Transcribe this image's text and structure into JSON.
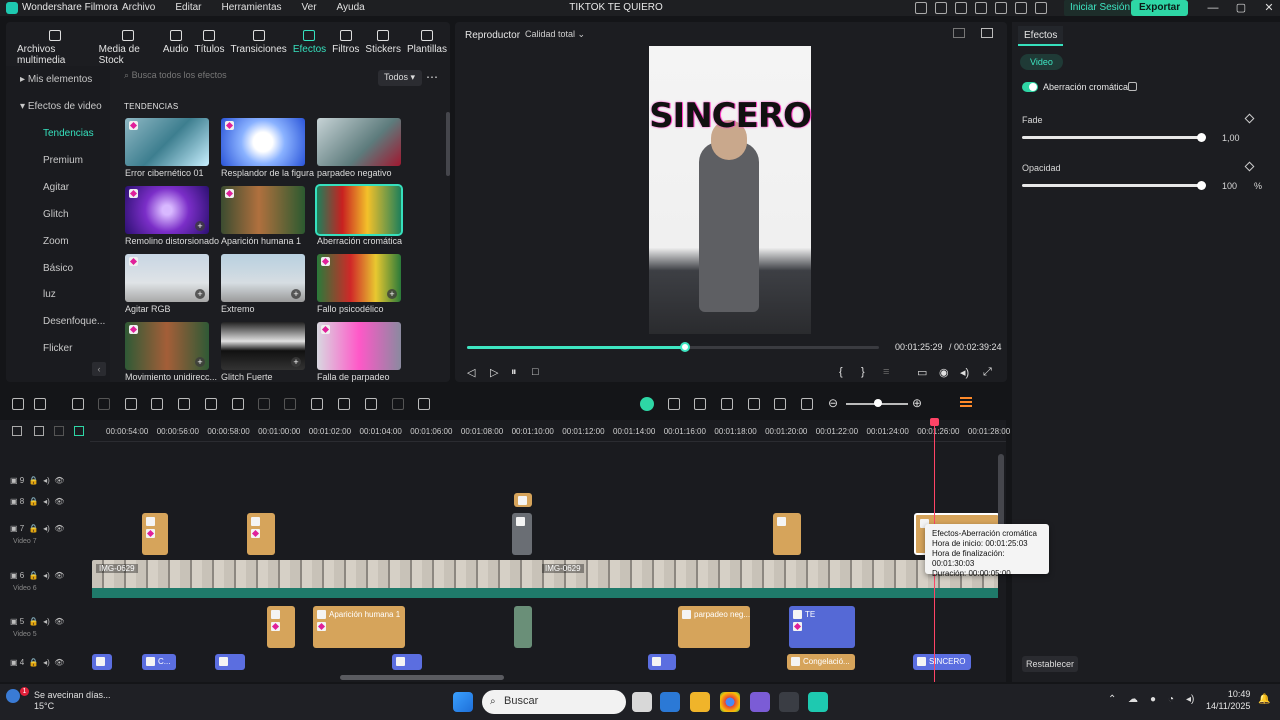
{
  "titlebar": {
    "app_name": "Wondershare Filmora",
    "menu": [
      "Archivo",
      "Editar",
      "Herramientas",
      "Ver",
      "Ayuda"
    ],
    "project_title": "TIKTOK TE QUIERO",
    "login_label": "Iniciar Sesión",
    "export_label": "Exportar"
  },
  "library": {
    "tabs": [
      "Archivos multimedia",
      "Media de Stock",
      "Audio",
      "Títulos",
      "Transiciones",
      "Efectos",
      "Filtros",
      "Stickers",
      "Plantillas"
    ],
    "active_tab": "Efectos",
    "sidebar": [
      "Mis elementos",
      "Efectos de video",
      "Tendencias",
      "Premium",
      "Agitar",
      "Glitch",
      "Zoom",
      "Básico",
      "luz",
      "Desenfoque...",
      "Flicker"
    ],
    "search_placeholder": "Busca todos los efectos",
    "filter_label": "Todos",
    "section_title": "TENDENCIAS",
    "effects": [
      "Error cibernético 01",
      "Resplandor de la figura",
      "parpadeo negativo",
      "Remolino distorsionado",
      "Aparición humana 1",
      "Aberración cromática",
      "Agitar RGB",
      "Extremo",
      "Fallo psicodélico",
      "Movimiento unidirecc...",
      "Glitch Fuerte",
      "Falla de parpadeo"
    ]
  },
  "player": {
    "label": "Reproductor",
    "quality": "Calidad total",
    "overlay_text": "SINCERO",
    "current_time": "00:01:25:29",
    "total_time": "/ 00:02:39:24",
    "progress_fraction": 0.53
  },
  "effects_panel": {
    "tab": "Efectos",
    "chip": "Video",
    "effect_name": "Aberración cromática",
    "fade_label": "Fade",
    "fade_value": "1,00",
    "opacity_label": "Opacidad",
    "opacity_value": "100",
    "opacity_unit": "%",
    "reset_label": "Restablecer"
  },
  "timeline": {
    "ruler": [
      "00:00:54:00",
      "00:00:56:00",
      "00:00:58:00",
      "00:01:00:00",
      "00:01:02:00",
      "00:01:04:00",
      "00:01:06:00",
      "00:01:08:00",
      "00:01:10:00",
      "00:01:12:00",
      "00:01:14:00",
      "00:01:16:00",
      "00:01:18:00",
      "00:01:20:00",
      "00:01:22:00",
      "00:01:24:00",
      "00:01:26:00",
      "00:01:28:00"
    ],
    "track_numbers": [
      "9",
      "8",
      "7",
      "6",
      "5",
      "4"
    ],
    "track_names": {
      "t7": "Video 7",
      "t6": "Video 6",
      "t5": "Video 5"
    },
    "video_clip_labels": [
      "IMG-0629",
      "IMG-0629"
    ],
    "clips": {
      "aparicion": "Aparición humana 1",
      "parpadeo": "parpadeo neg...",
      "te": "TE",
      "congelacion": "Congelació...",
      "sincero": "SINCERO",
      "c_title": "C..."
    },
    "tooltip": {
      "line1": "Efectos-Aberración cromática",
      "line2": "Hora de inicio: 00:01:25:03",
      "line3": "Hora de finalización: 00:01:30:03",
      "line4": "Duración: 00:00:05:00"
    }
  },
  "taskbar": {
    "weather_line1": "Se avecinan días...",
    "weather_line2": "15°C",
    "notification_count": "1",
    "search_label": "Buscar",
    "time": "10:49",
    "date": "14/11/2025"
  }
}
